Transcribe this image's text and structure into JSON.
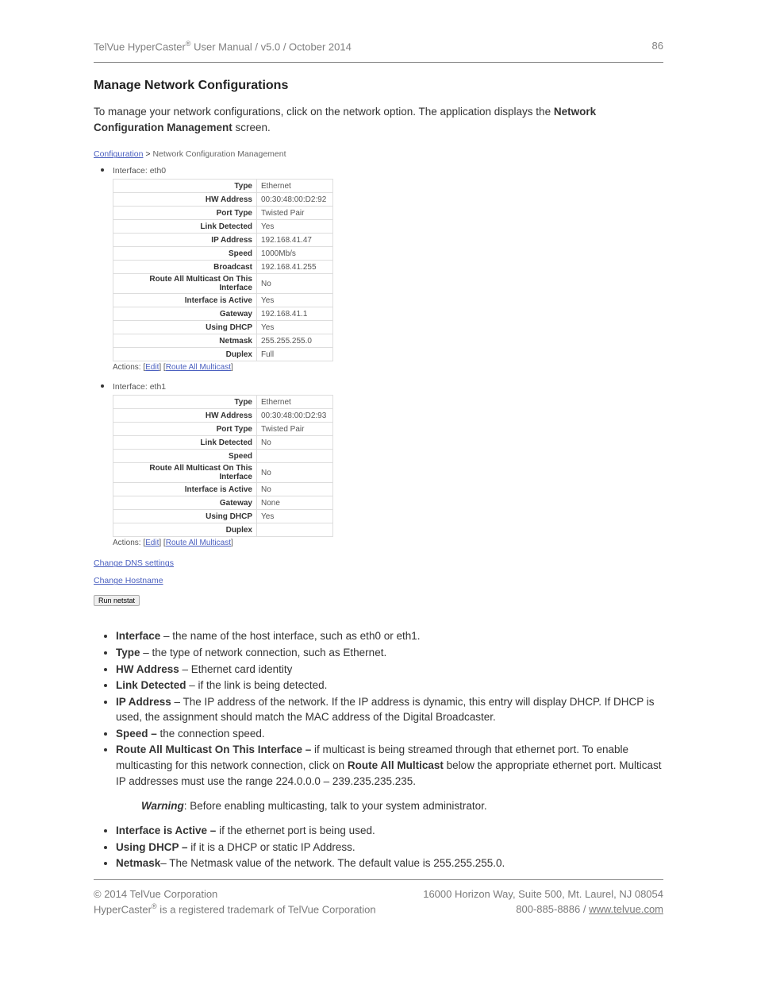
{
  "header": {
    "left_a": "TelVue HyperCaster",
    "left_b": " User Manual  / v5.0 / October 2014",
    "page": "86"
  },
  "title": "Manage Network Configurations",
  "intro_a": "To manage your network configurations, click on the network option. The application displays the ",
  "intro_b": "Network Configuration Management",
  "intro_c": " screen.",
  "breadcrumb": {
    "link": "Configuration",
    "sep": " > ",
    "current": "Network Configuration Management"
  },
  "interfaces": [
    {
      "name": "Interface: eth0",
      "rows": [
        {
          "k": "Type",
          "v": "Ethernet"
        },
        {
          "k": "HW Address",
          "v": "00:30:48:00:D2:92"
        },
        {
          "k": "Port Type",
          "v": "Twisted Pair"
        },
        {
          "k": "Link Detected",
          "v": "Yes"
        },
        {
          "k": "IP Address",
          "v": "192.168.41.47"
        },
        {
          "k": "Speed",
          "v": "1000Mb/s"
        },
        {
          "k": "Broadcast",
          "v": "192.168.41.255"
        },
        {
          "k": "Route All Multicast On This Interface",
          "v": "No"
        },
        {
          "k": "Interface is Active",
          "v": "Yes"
        },
        {
          "k": "Gateway",
          "v": "192.168.41.1"
        },
        {
          "k": "Using DHCP",
          "v": "Yes"
        },
        {
          "k": "Netmask",
          "v": "255.255.255.0"
        },
        {
          "k": "Duplex",
          "v": "Full"
        }
      ]
    },
    {
      "name": "Interface: eth1",
      "rows": [
        {
          "k": "Type",
          "v": "Ethernet"
        },
        {
          "k": "HW Address",
          "v": "00:30:48:00:D2:93"
        },
        {
          "k": "Port Type",
          "v": "Twisted Pair"
        },
        {
          "k": "Link Detected",
          "v": "No"
        },
        {
          "k": "Speed",
          "v": ""
        },
        {
          "k": "Route All Multicast On This Interface",
          "v": "No"
        },
        {
          "k": "Interface is Active",
          "v": "No"
        },
        {
          "k": "Gateway",
          "v": "None"
        },
        {
          "k": "Using DHCP",
          "v": "Yes"
        },
        {
          "k": "Duplex",
          "v": ""
        }
      ]
    }
  ],
  "actions": {
    "prefix": "Actions: [",
    "edit": "Edit",
    "sep": "] [",
    "route": "Route All Multicast",
    "suffix": "]"
  },
  "links": {
    "dns": "Change DNS settings",
    "host": "Change Hostname",
    "netstat": "Run netstat"
  },
  "defs1": [
    {
      "t": "Interface",
      "d": " – the name of the host interface, such as eth0 or eth1."
    },
    {
      "t": "Type",
      "d": " – the type of network connection, such as Ethernet."
    },
    {
      "t": "HW Address",
      "d": " – Ethernet card identity"
    },
    {
      "t": "Link Detected",
      "d": " – if the link is being detected."
    },
    {
      "t": "IP Address",
      "d": " – The IP address of the network. If the IP address is dynamic, this entry will display DHCP. If DHCP is used, the assignment should match the MAC address of the Digital Broadcaster."
    },
    {
      "t": "Speed – ",
      "d": "the connection speed."
    }
  ],
  "mc": {
    "t": "Route All Multicast On This Interface – ",
    "d1": "if multicast is being streamed through that ethernet port. To enable multicasting for this network connection, click on ",
    "b": "Route All Multicast",
    "d2": " below the appropriate ethernet port. Multicast IP addresses must use the range 224.0.0.0 – 239.235.235.235."
  },
  "warning": {
    "label": "Warning",
    "text": ": Before enabling multicasting, talk to your system administrator."
  },
  "defs2": [
    {
      "t": "Interface is Active – ",
      "d": "if the ethernet port is being used."
    },
    {
      "t": "Using DHCP – ",
      "d": "if it is a DHCP or static IP Address."
    },
    {
      "t": "Netmask",
      "d": "– The Netmask value of the network. The default value is 255.255.255.0."
    }
  ],
  "footer": {
    "l1a": "© 2014 TelVue Corporation",
    "l1b": "16000 Horizon Way, Suite 500, Mt. Laurel, NJ 08054",
    "l2a_a": "HyperCaster",
    "l2a_b": " is a registered trademark of TelVue Corporation",
    "l2b_a": "800-885-8886  / ",
    "l2b_link": "www.telvue.com"
  }
}
